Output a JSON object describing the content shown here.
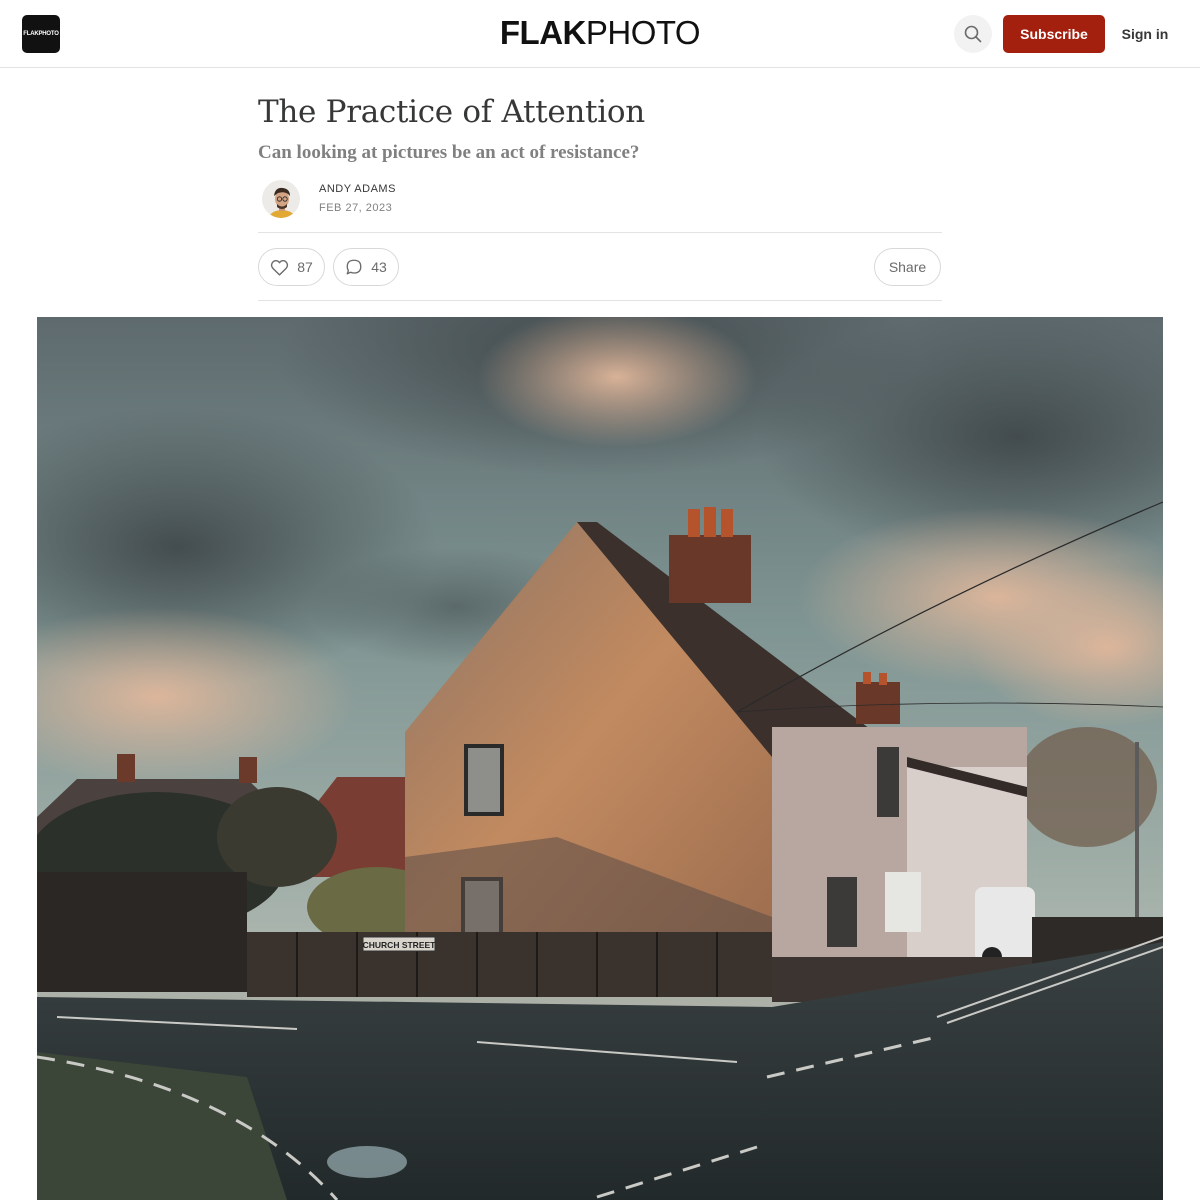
{
  "header": {
    "logo_text": "FLAKPHOTO",
    "wordmark_bold": "FLAK",
    "wordmark_light": "PHOTO",
    "search_icon": "search-icon",
    "subscribe_label": "Subscribe",
    "signin_label": "Sign in",
    "accent_color": "#a3200f"
  },
  "post": {
    "title": "The Practice of Attention",
    "subtitle": "Can looking at pictures be an act of resistance?",
    "author": "ANDY ADAMS",
    "date": "FEB 27, 2023",
    "like_count": "87",
    "comment_count": "43",
    "share_label": "Share",
    "icons": [
      "heart-icon",
      "comment-icon"
    ]
  },
  "hero": {
    "sign_text": "CHURCH STREET"
  }
}
